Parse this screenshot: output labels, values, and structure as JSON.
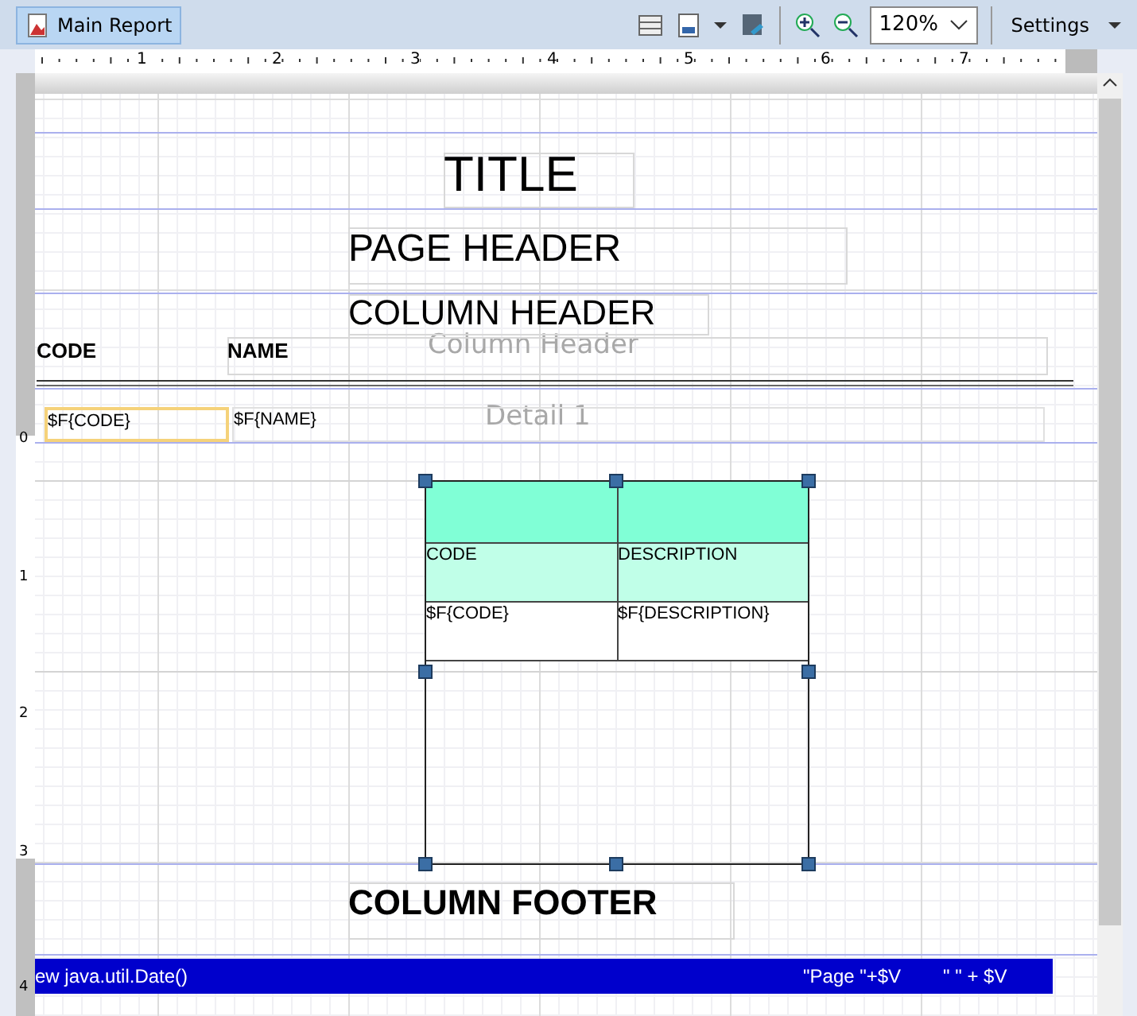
{
  "toolbar": {
    "report_tab": {
      "label": "Main Report",
      "selected": true
    },
    "zoom": "120%",
    "settings": "Settings"
  },
  "ruler": {
    "marks": [
      "1",
      "2",
      "3",
      "4",
      "5",
      "6",
      "7"
    ]
  },
  "vertical_ruler": {
    "marks": [
      "0",
      "1",
      "2",
      "3",
      "4"
    ]
  },
  "bands": [
    {
      "label": "Column Header"
    },
    {
      "label": "Detail 1"
    }
  ],
  "title": "TITLE",
  "page_header": "PAGE HEADER",
  "column_header": "COLUMN HEADER",
  "column_labels": [
    "CODE",
    "NAME"
  ],
  "detail_fields": [
    {
      "text": "$F{CODE}",
      "selected": true
    },
    {
      "text": "$F{NAME}",
      "selected": false
    }
  ],
  "table": {
    "header": [
      "CODE",
      "DESCRIPTION"
    ],
    "row": [
      "$F{CODE}",
      "$F{DESCRIPTION}"
    ]
  },
  "column_footer": "COLUMN FOOTER",
  "page_footer": [
    "ew java.util.Date()",
    "\"Page \"+$V",
    "\" \" + $V"
  ]
}
